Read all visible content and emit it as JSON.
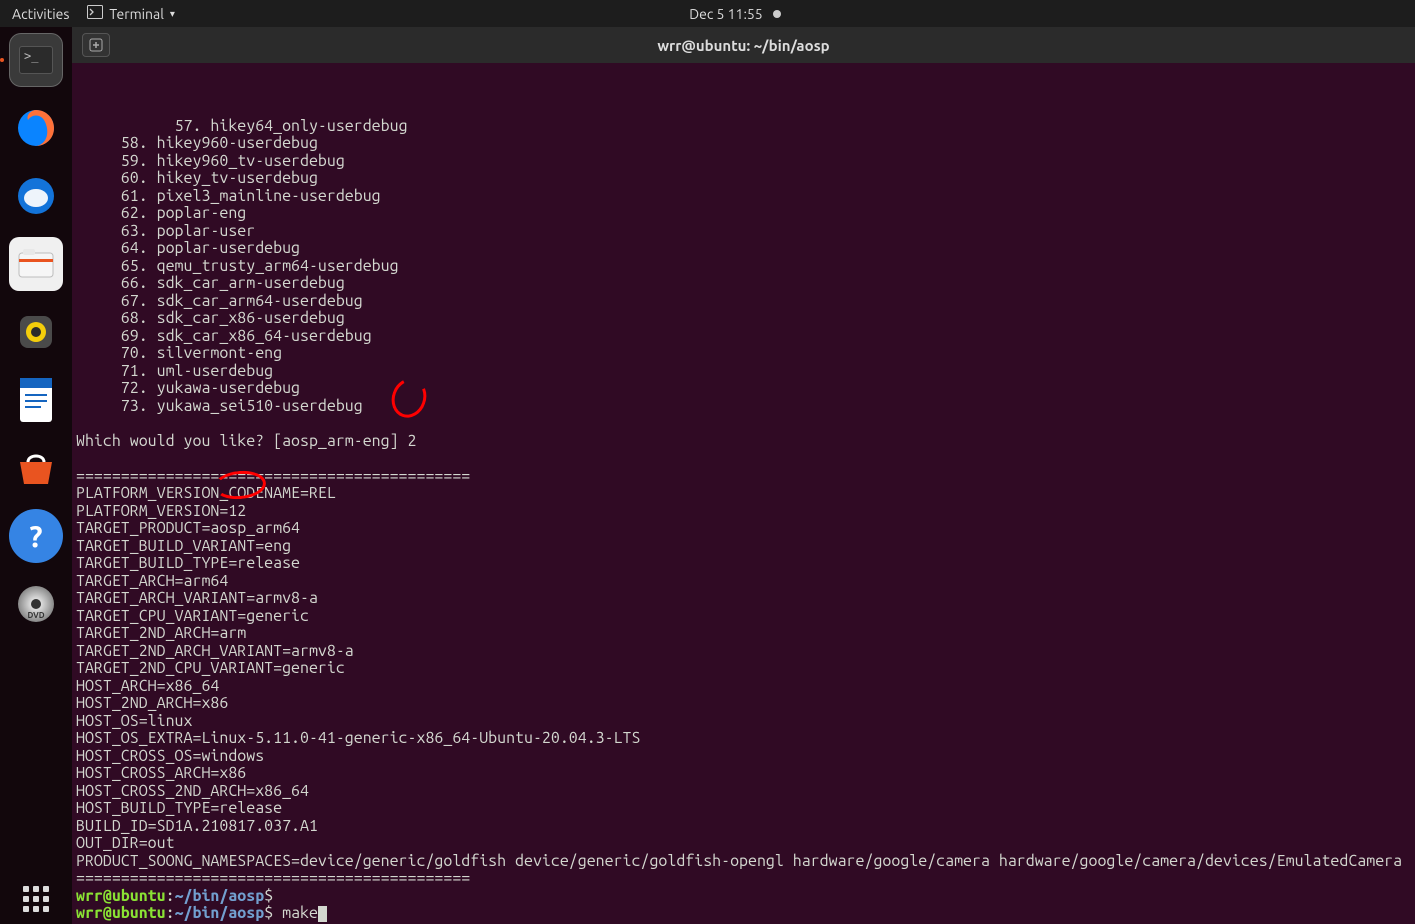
{
  "toppanel": {
    "activities": "Activities",
    "app_name": "Terminal",
    "datetime": "Dec 5  11:55"
  },
  "window": {
    "title": "wrr@ubuntu: ~/bin/aosp"
  },
  "lunch_menu": [
    {
      "n": "57",
      "name": "hikey64_only-userdebug"
    },
    {
      "n": "58",
      "name": "hikey960-userdebug"
    },
    {
      "n": "59",
      "name": "hikey960_tv-userdebug"
    },
    {
      "n": "60",
      "name": "hikey_tv-userdebug"
    },
    {
      "n": "61",
      "name": "pixel3_mainline-userdebug"
    },
    {
      "n": "62",
      "name": "poplar-eng"
    },
    {
      "n": "63",
      "name": "poplar-user"
    },
    {
      "n": "64",
      "name": "poplar-userdebug"
    },
    {
      "n": "65",
      "name": "qemu_trusty_arm64-userdebug"
    },
    {
      "n": "66",
      "name": "sdk_car_arm-userdebug"
    },
    {
      "n": "67",
      "name": "sdk_car_arm64-userdebug"
    },
    {
      "n": "68",
      "name": "sdk_car_x86-userdebug"
    },
    {
      "n": "69",
      "name": "sdk_car_x86_64-userdebug"
    },
    {
      "n": "70",
      "name": "silvermont-eng"
    },
    {
      "n": "71",
      "name": "uml-userdebug"
    },
    {
      "n": "72",
      "name": "yukawa-userdebug"
    },
    {
      "n": "73",
      "name": "yukawa_sei510-userdebug"
    }
  ],
  "prompt_question": "Which would you like? [aosp_arm-eng] ",
  "prompt_answer": "2",
  "divider": "============================================",
  "build_vars": [
    "PLATFORM_VERSION_CODENAME=REL",
    "PLATFORM_VERSION=12",
    "TARGET_PRODUCT=aosp_arm64",
    "TARGET_BUILD_VARIANT=eng",
    "TARGET_BUILD_TYPE=release",
    "TARGET_ARCH=arm64",
    "TARGET_ARCH_VARIANT=armv8-a",
    "TARGET_CPU_VARIANT=generic",
    "TARGET_2ND_ARCH=arm",
    "TARGET_2ND_ARCH_VARIANT=armv8-a",
    "TARGET_2ND_CPU_VARIANT=generic",
    "HOST_ARCH=x86_64",
    "HOST_2ND_ARCH=x86",
    "HOST_OS=linux",
    "HOST_OS_EXTRA=Linux-5.11.0-41-generic-x86_64-Ubuntu-20.04.3-LTS",
    "HOST_CROSS_OS=windows",
    "HOST_CROSS_ARCH=x86",
    "HOST_CROSS_2ND_ARCH=x86_64",
    "HOST_BUILD_TYPE=release",
    "BUILD_ID=SD1A.210817.037.A1",
    "OUT_DIR=out",
    "PRODUCT_SOONG_NAMESPACES=device/generic/goldfish device/generic/goldfish-opengl hardware/google/camera hardware/google/camera/devices/EmulatedCamera"
  ],
  "shell_prompt": {
    "user_host": "wrr@ubuntu",
    "sep": ":",
    "path": "~/bin/aosp",
    "dollar": "$",
    "cmd1": " ",
    "cmd2": " make"
  }
}
